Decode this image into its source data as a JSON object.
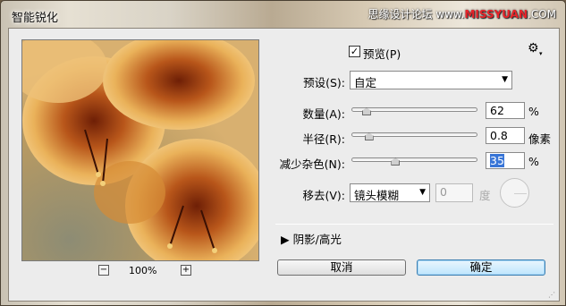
{
  "window": {
    "title": "智能锐化",
    "watermark_prefix": "思缘设计论坛 www.",
    "watermark_brand": "MISSYUAN",
    "watermark_suffix": ".COM"
  },
  "preview": {
    "zoom_level": "100%",
    "zoom_out_label": "−",
    "zoom_in_label": "+"
  },
  "options": {
    "preview_label": "预览(P)",
    "preview_checked": "✓",
    "gear_icon": "⚙",
    "gear_caret": "▾"
  },
  "preset": {
    "label": "预设(S):",
    "value": "自定",
    "arrow": "▼"
  },
  "amount": {
    "label": "数量(A):",
    "value": "62",
    "unit": "%",
    "slider_fraction": 0.12
  },
  "radius": {
    "label": "半径(R):",
    "value": "0.8",
    "unit": "像素",
    "slider_fraction": 0.14
  },
  "noise": {
    "label": "减少杂色(N):",
    "value": "35",
    "unit": "%",
    "slider_fraction": 0.35
  },
  "remove": {
    "label": "移去(V):",
    "value": "镜头模糊",
    "arrow": "▼",
    "angle_value": "0",
    "angle_unit": "度"
  },
  "shadows_highlights": {
    "arrow": "▶",
    "label": "阴影/高光"
  },
  "buttons": {
    "cancel": "取消",
    "ok": "确定"
  },
  "colors": {
    "accent": "#3875d7",
    "photo_orange": "#e0a23e",
    "photo_red": "#7b2a0c"
  }
}
